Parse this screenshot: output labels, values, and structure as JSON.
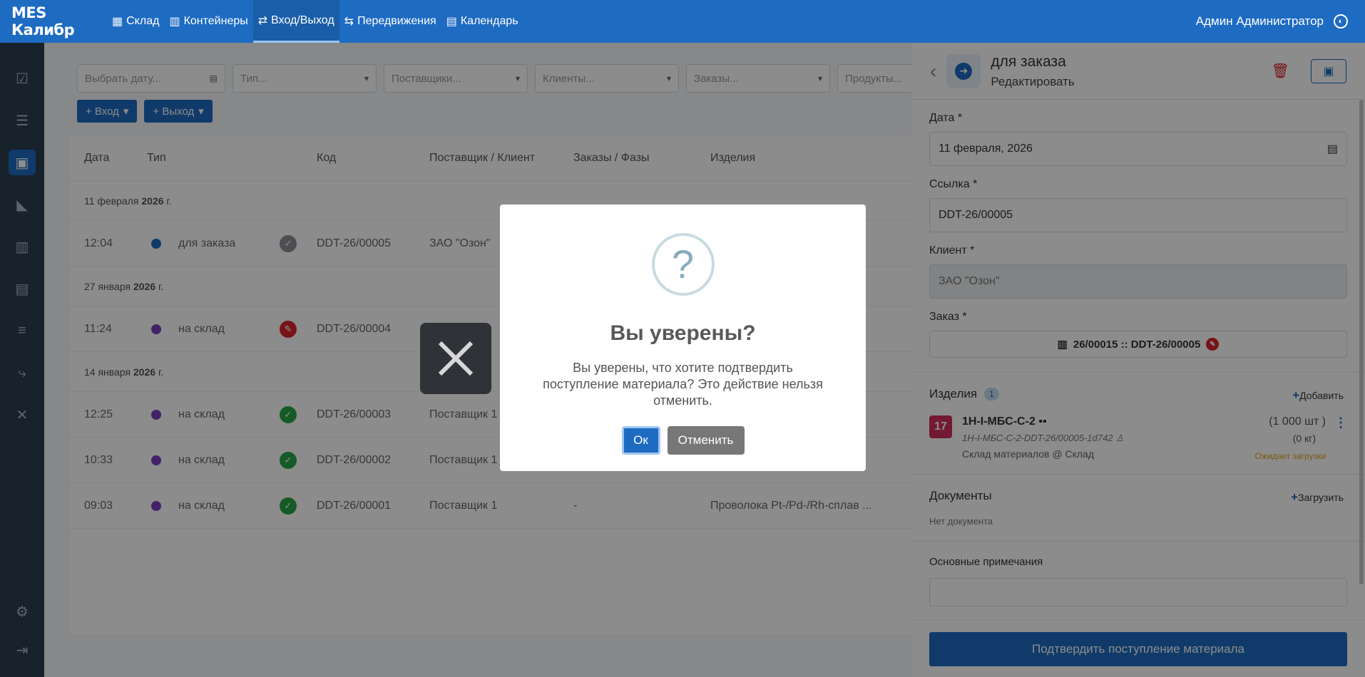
{
  "topbar": {
    "brand": "MES Калибр",
    "nav": [
      {
        "label": "Склад",
        "icon": "warehouse-icon"
      },
      {
        "label": "Контейнеры",
        "icon": "containers-icon"
      },
      {
        "label": "Вход/Выход",
        "icon": "in-out-icon",
        "active": true
      },
      {
        "label": "Передвижения",
        "icon": "transfer-icon"
      },
      {
        "label": "Календарь",
        "icon": "calendar-icon"
      }
    ],
    "user": "Админ Администратор"
  },
  "filters": {
    "date_placeholder": "Выбрать дату...",
    "type_placeholder": "Тип...",
    "supplier_placeholder": "Поставщики...",
    "client_placeholder": "Клиенты...",
    "orders_placeholder": "Заказы...",
    "products_placeholder": "Продукты..."
  },
  "actions": {
    "in_label": "+ Вход",
    "out_label": "+ Выход"
  },
  "table": {
    "headers": [
      "Дата",
      "Тип",
      "Код",
      "Поставщик / Клиент",
      "Заказы / Фазы",
      "Изделия"
    ],
    "groups": [
      {
        "date_prefix": "11 февраля",
        "date_year": "2026",
        "date_suffix": "г."
      },
      {
        "date_prefix": "27 января",
        "date_year": "2026",
        "date_suffix": "г."
      },
      {
        "date_prefix": "14 января",
        "date_year": "2026",
        "date_suffix": "г."
      }
    ],
    "rows": [
      {
        "time": "12:04",
        "type": "для заказа",
        "code": "DDT-26/00005",
        "party": "ЗАО \"Озон\"",
        "orders": "",
        "product": ""
      },
      {
        "time": "11:24",
        "type": "на склад",
        "code": "DDT-26/00004",
        "party": "",
        "orders": "",
        "product": ""
      },
      {
        "time": "12:25",
        "type": "на склад",
        "code": "DDT-26/00003",
        "party": "Поставщик 1",
        "orders": "",
        "product": ""
      },
      {
        "time": "10:33",
        "type": "на склад",
        "code": "DDT-26/00002",
        "party": "Поставщик 1",
        "orders": "",
        "product": ""
      },
      {
        "time": "09:03",
        "type": "на склад",
        "code": "DDT-26/00001",
        "party": "Поставщик 1",
        "orders": "-",
        "product": "Проволока Pt-/Pd-/Rh-сплав ... "
      }
    ]
  },
  "panel": {
    "title": "для заказа",
    "subtitle": "Редактировать",
    "date_label": "Дата *",
    "date_value": "11 февраля, 2026",
    "ref_label": "Ссылка *",
    "ref_value": "DDT-26/00005",
    "client_label": "Клиент *",
    "client_value": "ЗАО \"Озон\"",
    "order_label": "Заказ *",
    "order_value": "26/00015 :: DDT-26/00005",
    "items_title": "Изделия",
    "items_count": "1",
    "add_label": "Добавить",
    "item": {
      "number": "17",
      "name": "1H-I-МБС-С-2",
      "code": "1H-I-МБС-С-2-DDT-26/00005-1d742",
      "location": "Склад материалов @ Склад",
      "qty": "(1 000 шт )",
      "weight": "(0 кг)",
      "status": "Ожидает загрузки"
    },
    "docs_title": "Документы",
    "upload_label": "Загрузить",
    "no_docs": "Нет документа",
    "notes_title": "Основные примечания",
    "confirm_label": "Подтвердить поступление материала"
  },
  "modal": {
    "icon": "?",
    "title": "Вы уверены?",
    "text": "Вы уверены, что хотите подтвердить поступление материала? Это действие нельзя отменить.",
    "ok_label": "Ок",
    "cancel_label": "Отменить"
  },
  "colors": {
    "primary": "#1e6bc2",
    "danger": "#d9262f",
    "success": "#28a745",
    "warning": "#e6a21a"
  }
}
